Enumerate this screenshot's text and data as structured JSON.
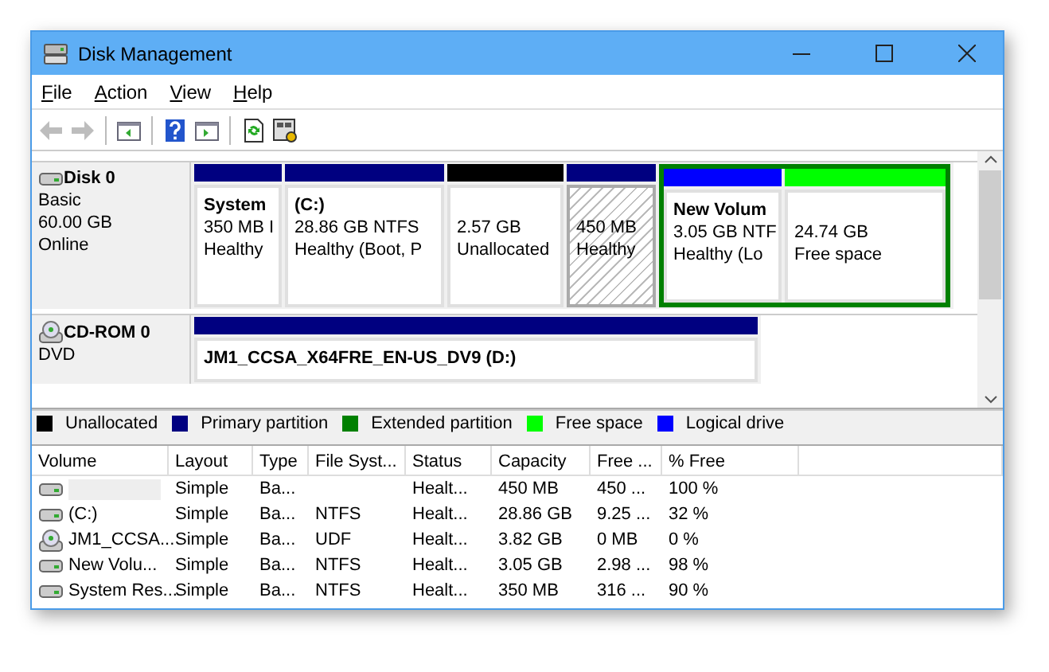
{
  "window": {
    "title": "Disk Management"
  },
  "menu": [
    {
      "label": "File"
    },
    {
      "label": "Action"
    },
    {
      "label": "View"
    },
    {
      "label": "Help"
    }
  ],
  "toolbar": [
    {
      "kind": "back",
      "disabled": true
    },
    {
      "kind": "forward",
      "disabled": true
    },
    {
      "kind": "sep"
    },
    {
      "kind": "tree",
      "disabled": false
    },
    {
      "kind": "sep"
    },
    {
      "kind": "help",
      "disabled": false
    },
    {
      "kind": "pane",
      "disabled": false
    },
    {
      "kind": "sep"
    },
    {
      "kind": "refresh",
      "disabled": false
    },
    {
      "kind": "props",
      "disabled": false
    }
  ],
  "disks": [
    {
      "kind": "hdd",
      "name": "Disk 0",
      "details": [
        "Basic",
        "60.00 GB",
        "Online"
      ],
      "partitions": [
        {
          "kind": "volume",
          "color": "#000080",
          "title": "System",
          "lines": [
            "350 MB I",
            "Healthy"
          ],
          "selected": false
        },
        {
          "kind": "volume",
          "color": "#000080",
          "title": "(C:)",
          "lines": [
            "28.86 GB NTFS",
            "Healthy (Boot, P"
          ],
          "selected": false
        },
        {
          "kind": "volume",
          "color": "#000000",
          "lines": [
            "2.57 GB",
            "Unallocated"
          ],
          "selected": false
        },
        {
          "kind": "volume",
          "color": "#000080",
          "lines": [
            "450 MB",
            "Healthy"
          ],
          "selected": true
        },
        {
          "kind": "extended",
          "color": "#008000",
          "children": [
            {
              "kind": "volume",
              "color": "#0000ff",
              "title": "New Volum",
              "lines": [
                "3.05 GB NTF",
                "Healthy (Lo"
              ],
              "selected": false
            },
            {
              "kind": "volume",
              "color": "#00ff00",
              "lines": [
                "24.74 GB",
                "Free space"
              ],
              "selected": false
            }
          ]
        }
      ]
    },
    {
      "kind": "cdrom",
      "name": "CD-ROM 0",
      "details": [
        "DVD"
      ],
      "partitions": [
        {
          "kind": "volume",
          "color": "#000080",
          "title": "JM1_CCSA_X64FRE_EN-US_DV9  (D:)",
          "selected": false
        }
      ]
    }
  ],
  "legend": [
    {
      "label": "Unallocated",
      "color": "#000000"
    },
    {
      "label": "Primary partition",
      "color": "#000080"
    },
    {
      "label": "Extended partition",
      "color": "#008000"
    },
    {
      "label": "Free space",
      "color": "#00ff00"
    },
    {
      "label": "Logical drive",
      "color": "#0000ff"
    }
  ],
  "table": {
    "columns": [
      "Volume",
      "Layout",
      "Type",
      "File Syst...",
      "Status",
      "Capacity",
      "Free ...",
      "% Free"
    ],
    "rows": [
      {
        "kind": "hdd",
        "cells": [
          null,
          "Simple",
          "Ba...",
          null,
          "Healt...",
          "450 MB",
          "450 ...",
          "100 %"
        ]
      },
      {
        "kind": "hdd",
        "cells": [
          "(C:)",
          "Simple",
          "Ba...",
          "NTFS",
          "Healt...",
          "28.86 GB",
          "9.25 ...",
          "32 %"
        ]
      },
      {
        "kind": "cdrom",
        "cells": [
          "JM1_CCSA...",
          "Simple",
          "Ba...",
          "UDF",
          "Healt...",
          "3.82 GB",
          "0 MB",
          "0 %"
        ]
      },
      {
        "kind": "hdd",
        "cells": [
          "New Volu...",
          "Simple",
          "Ba...",
          "NTFS",
          "Healt...",
          "3.05 GB",
          "2.98 ...",
          "98 %"
        ]
      },
      {
        "kind": "hdd",
        "cells": [
          "System Res...",
          "Simple",
          "Ba...",
          "NTFS",
          "Healt...",
          "350 MB",
          "316 ...",
          "90 %"
        ]
      }
    ]
  }
}
